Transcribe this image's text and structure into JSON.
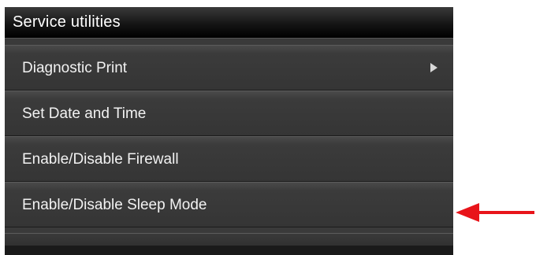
{
  "header": {
    "title": "Service utilities"
  },
  "menu": {
    "items": [
      {
        "label": "Diagnostic Print",
        "has_submenu": true
      },
      {
        "label": "Set Date and Time",
        "has_submenu": false
      },
      {
        "label": "Enable/Disable Firewall",
        "has_submenu": false
      },
      {
        "label": "Enable/Disable Sleep Mode",
        "has_submenu": false
      }
    ]
  },
  "annotation": {
    "arrow_color": "#e8141a",
    "arrow_icon": "left-arrow-icon"
  },
  "colors": {
    "panel_bg": "#3a3a3a",
    "text": "#f2f2f2"
  }
}
